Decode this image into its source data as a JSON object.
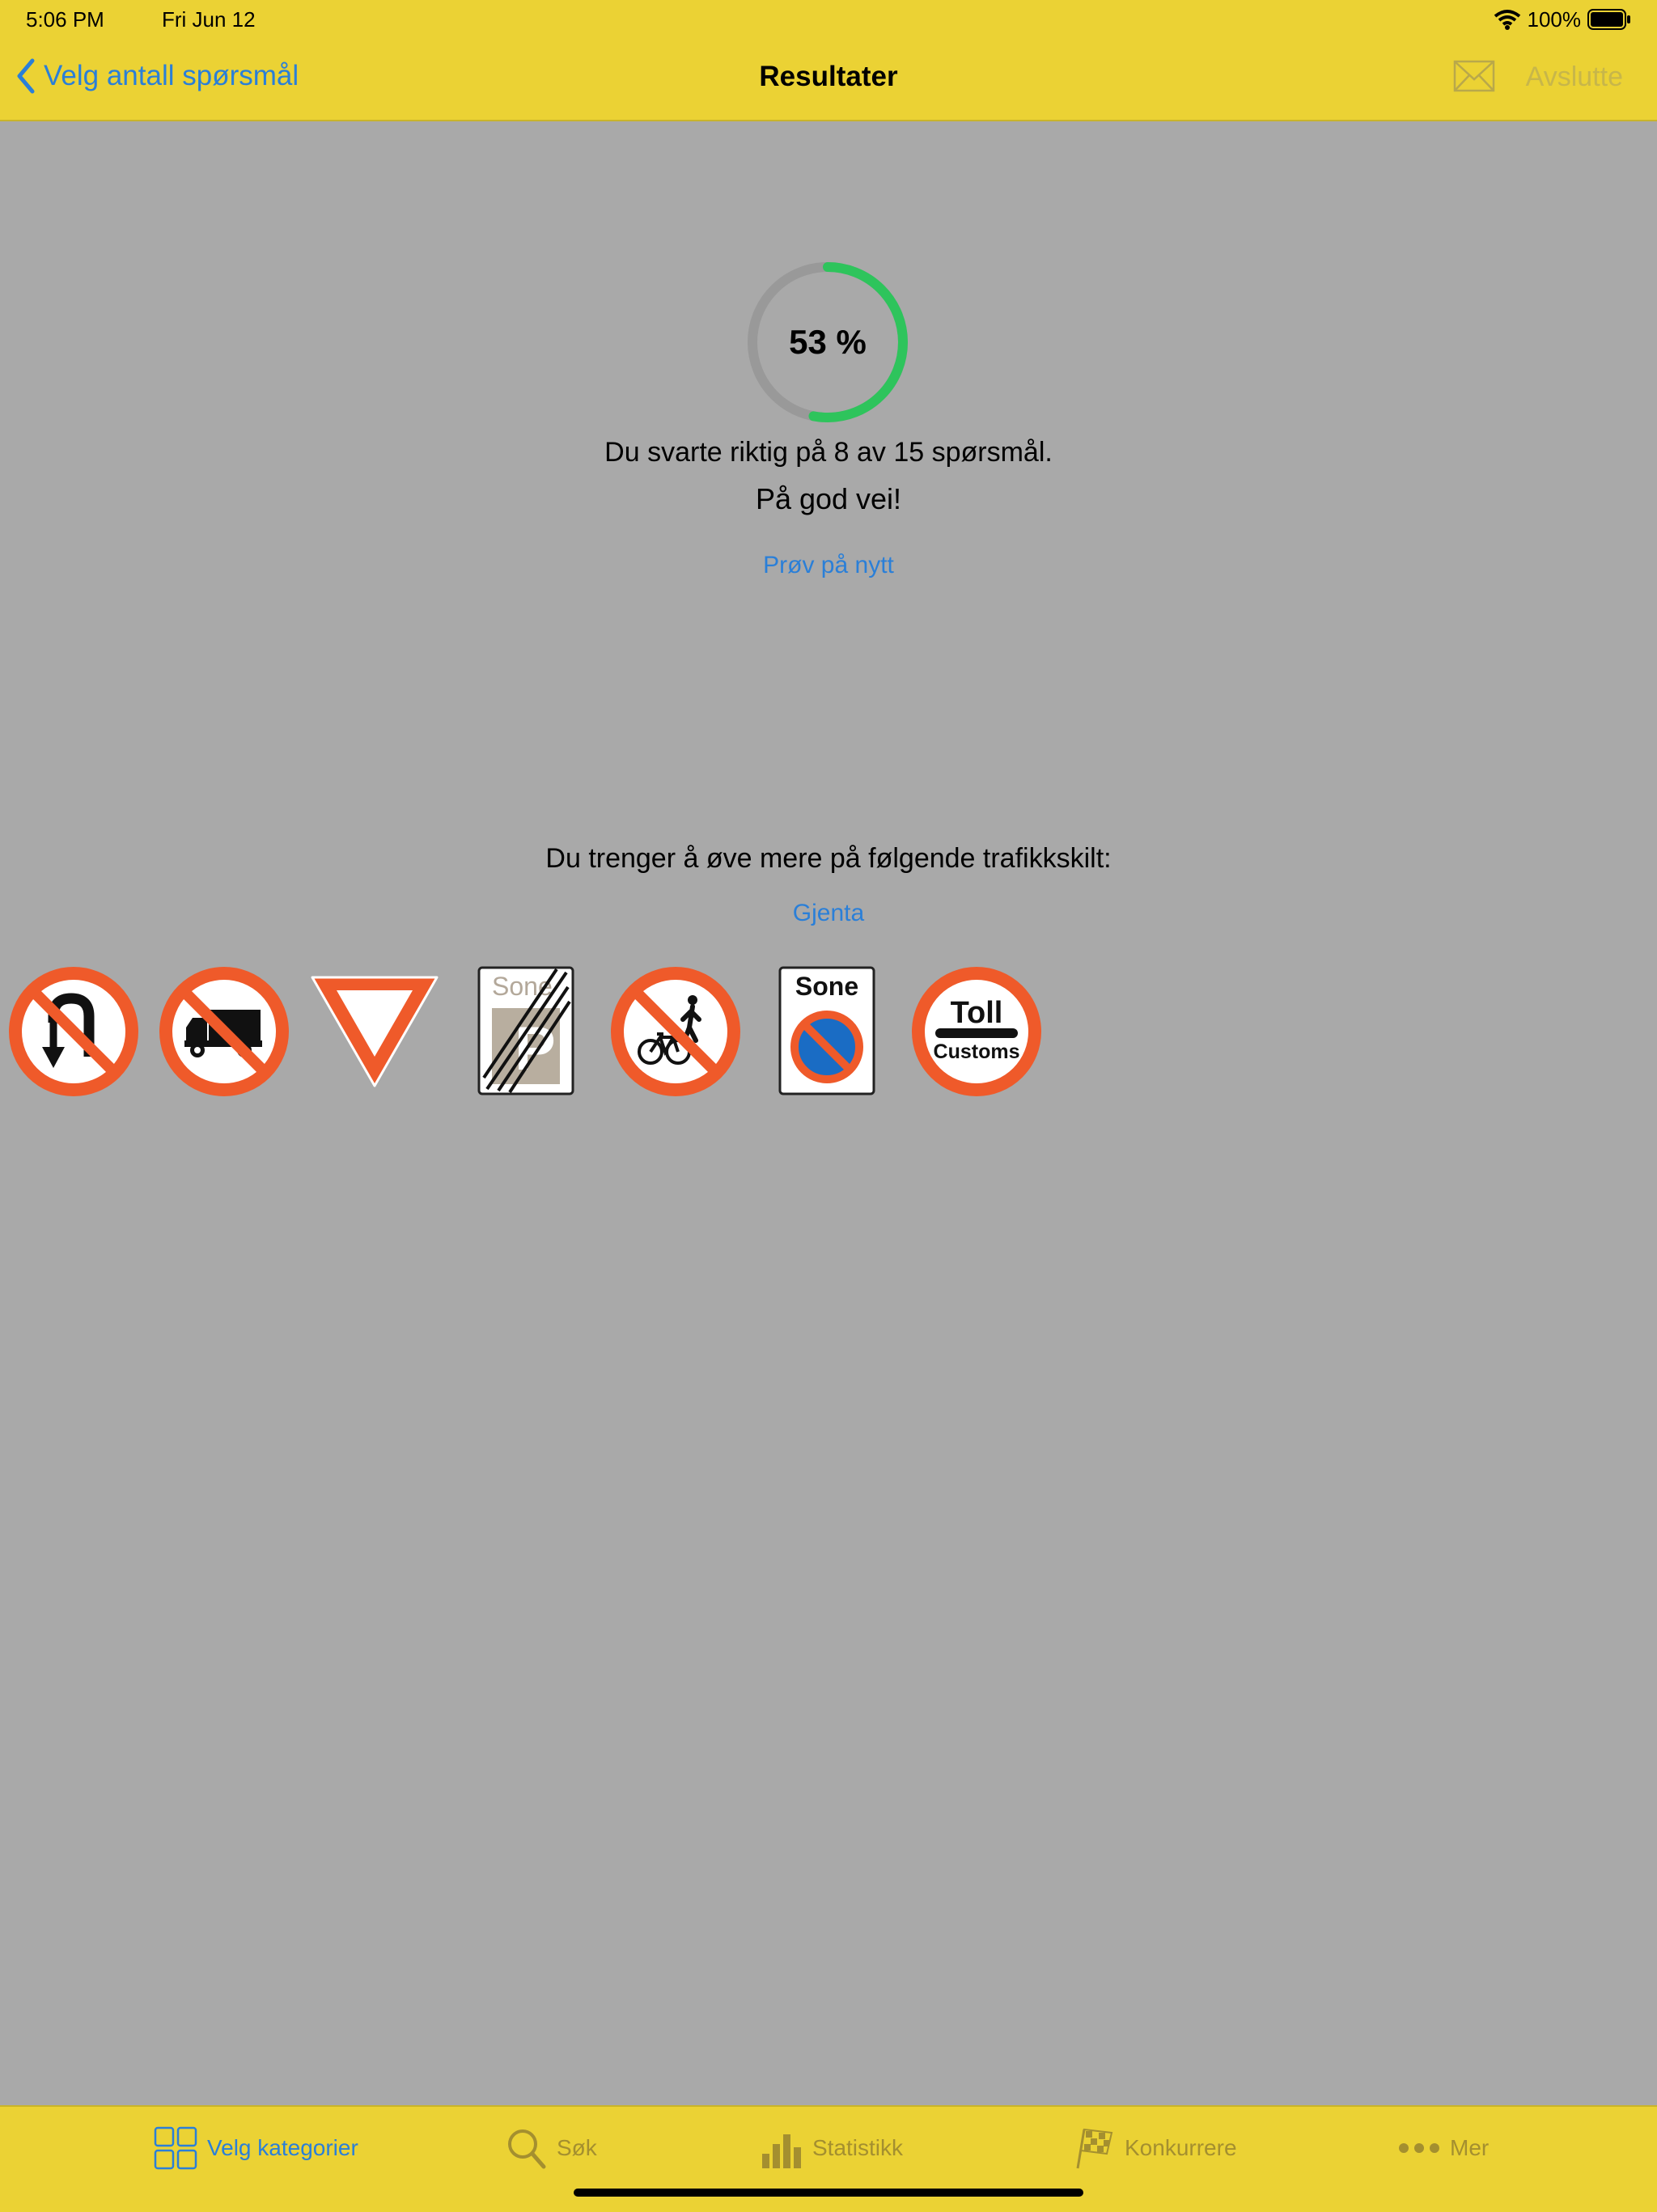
{
  "status": {
    "time": "5:06 PM",
    "date": "Fri Jun 12",
    "battery": "100%"
  },
  "nav": {
    "back_label": "Velg antall spørsmål",
    "title": "Resultater",
    "exit_label": "Avslutte"
  },
  "result": {
    "percent_label": "53 %",
    "percent": 53,
    "summary": "Du svarte riktig på 8 av 15 spørsmål.",
    "comment": "På god vei!",
    "retry_label": "Prøv på nytt"
  },
  "practice": {
    "title": "Du trenger å øve mere på følgende trafikkskilt:",
    "repeat_label": "Gjenta",
    "signs": [
      {
        "name": "no-u-turn-sign"
      },
      {
        "name": "no-trucks-sign"
      },
      {
        "name": "yield-sign"
      },
      {
        "name": "end-parking-zone-sign",
        "text": "Sone"
      },
      {
        "name": "no-bicycles-pedestrians-sign"
      },
      {
        "name": "no-parking-zone-sign",
        "text": "Sone"
      },
      {
        "name": "toll-customs-sign",
        "text_top": "Toll",
        "text_bottom": "Customs"
      }
    ]
  },
  "tabs": [
    {
      "label": "Velg kategorier",
      "icon": "grid-icon",
      "active": true
    },
    {
      "label": "Søk",
      "icon": "search-icon",
      "active": false
    },
    {
      "label": "Statistikk",
      "icon": "bar-chart-icon",
      "active": false
    },
    {
      "label": "Konkurrere",
      "icon": "checkered-flag-icon",
      "active": false
    },
    {
      "label": "Mer",
      "icon": "more-icon",
      "active": false
    }
  ],
  "colors": {
    "bar": "#ebd234",
    "background": "#a9a9a9",
    "accent": "#2a7fd8",
    "progress": "#2ec45c",
    "sign_red": "#ef5a2a"
  }
}
